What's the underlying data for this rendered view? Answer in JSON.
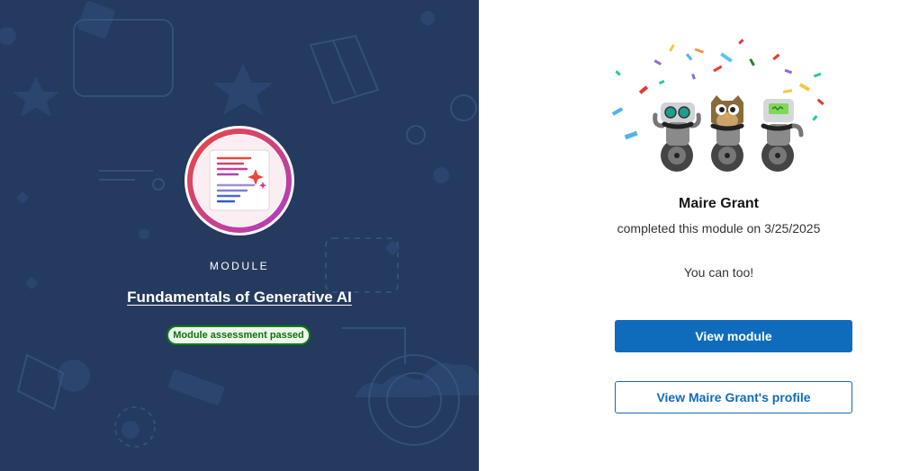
{
  "module": {
    "kicker": "MODULE",
    "title": "Fundamentals of Generative AI",
    "status_badge": "Module assessment passed",
    "badge_icon": "document-sparkle-icon"
  },
  "achievement": {
    "user_name": "Maire Grant",
    "completed_text": "completed this module on 3/25/2025",
    "cta_text": "You can too!",
    "illustration": "celebrating-mascots-on-unicycles"
  },
  "actions": {
    "view_module_label": "View module",
    "view_profile_label": "View Maire Grant's profile"
  },
  "colors": {
    "left_background": "#243a5e",
    "primary_button": "#0f6cbd",
    "pass_badge_border": "#107c10",
    "badge_ring_start": "#e9483c",
    "badge_ring_end": "#b03cc8"
  }
}
